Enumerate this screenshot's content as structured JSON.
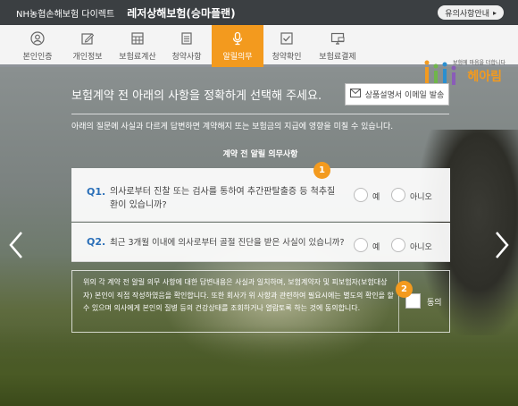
{
  "header": {
    "brand": "NH농협손해보험 다이렉트",
    "product_title": "레저상해보험(승마플랜)",
    "notice_button": "유의사항안내"
  },
  "steps": [
    {
      "label": "본인인증",
      "icon": "person-icon"
    },
    {
      "label": "개인정보",
      "icon": "edit-icon"
    },
    {
      "label": "보험료계산",
      "icon": "calculator-icon"
    },
    {
      "label": "청약사항",
      "icon": "document-icon"
    },
    {
      "label": "알릴의무",
      "icon": "microphone-icon",
      "active": true
    },
    {
      "label": "청약확인",
      "icon": "checkbox-icon"
    },
    {
      "label": "보험료결제",
      "icon": "monitor-card-icon"
    }
  ],
  "logo": {
    "sub": "보험에 마음을 더합니다",
    "name": "헤아림"
  },
  "main": {
    "heading": "보험계약 전 아래의 사항을 정확하게 선택해 주세요.",
    "email_button": "상품설명서 이메일 발송",
    "subtext": "아래의 질문에 사실과 다르게 답변하면 계약해지 또는 보험금의 지급에 영향을 미칠 수 있습니다.",
    "section_title": "계약 전 알릴 의무사항",
    "questions": [
      {
        "num": "Q1.",
        "text": "의사로부터 진찰 또는 검사를 통하여 추간판탈출증 등 척추질환이 있습니까?",
        "yes": "예",
        "no": "아니오"
      },
      {
        "num": "Q2.",
        "text": "최근 3개월 이내에 의사로부터 골절 진단을 받은 사실이 있습니까?",
        "yes": "예",
        "no": "아니오"
      }
    ],
    "consent_text": "위의 각 계약 전 알릴 의무 사항에 대한 답변내용은 사실과 일치하며, 보험계약자 및 피보험자(보험대상자) 본인이 직접 작성하였음을 확인합니다. 또한 회사가 위 사항과 관련하여 필요시에는 별도의 확인을 할 수 있으며 의사에게 본인의 질병 등의 건강상태를 조회하거나 열람토록 하는 것에 동의합니다.",
    "agree_label": "동의",
    "badges": [
      "1",
      "2"
    ]
  },
  "colors": {
    "accent": "#f39a1e",
    "question_number": "#2a6fb8",
    "topbar": "#3b3f42"
  }
}
